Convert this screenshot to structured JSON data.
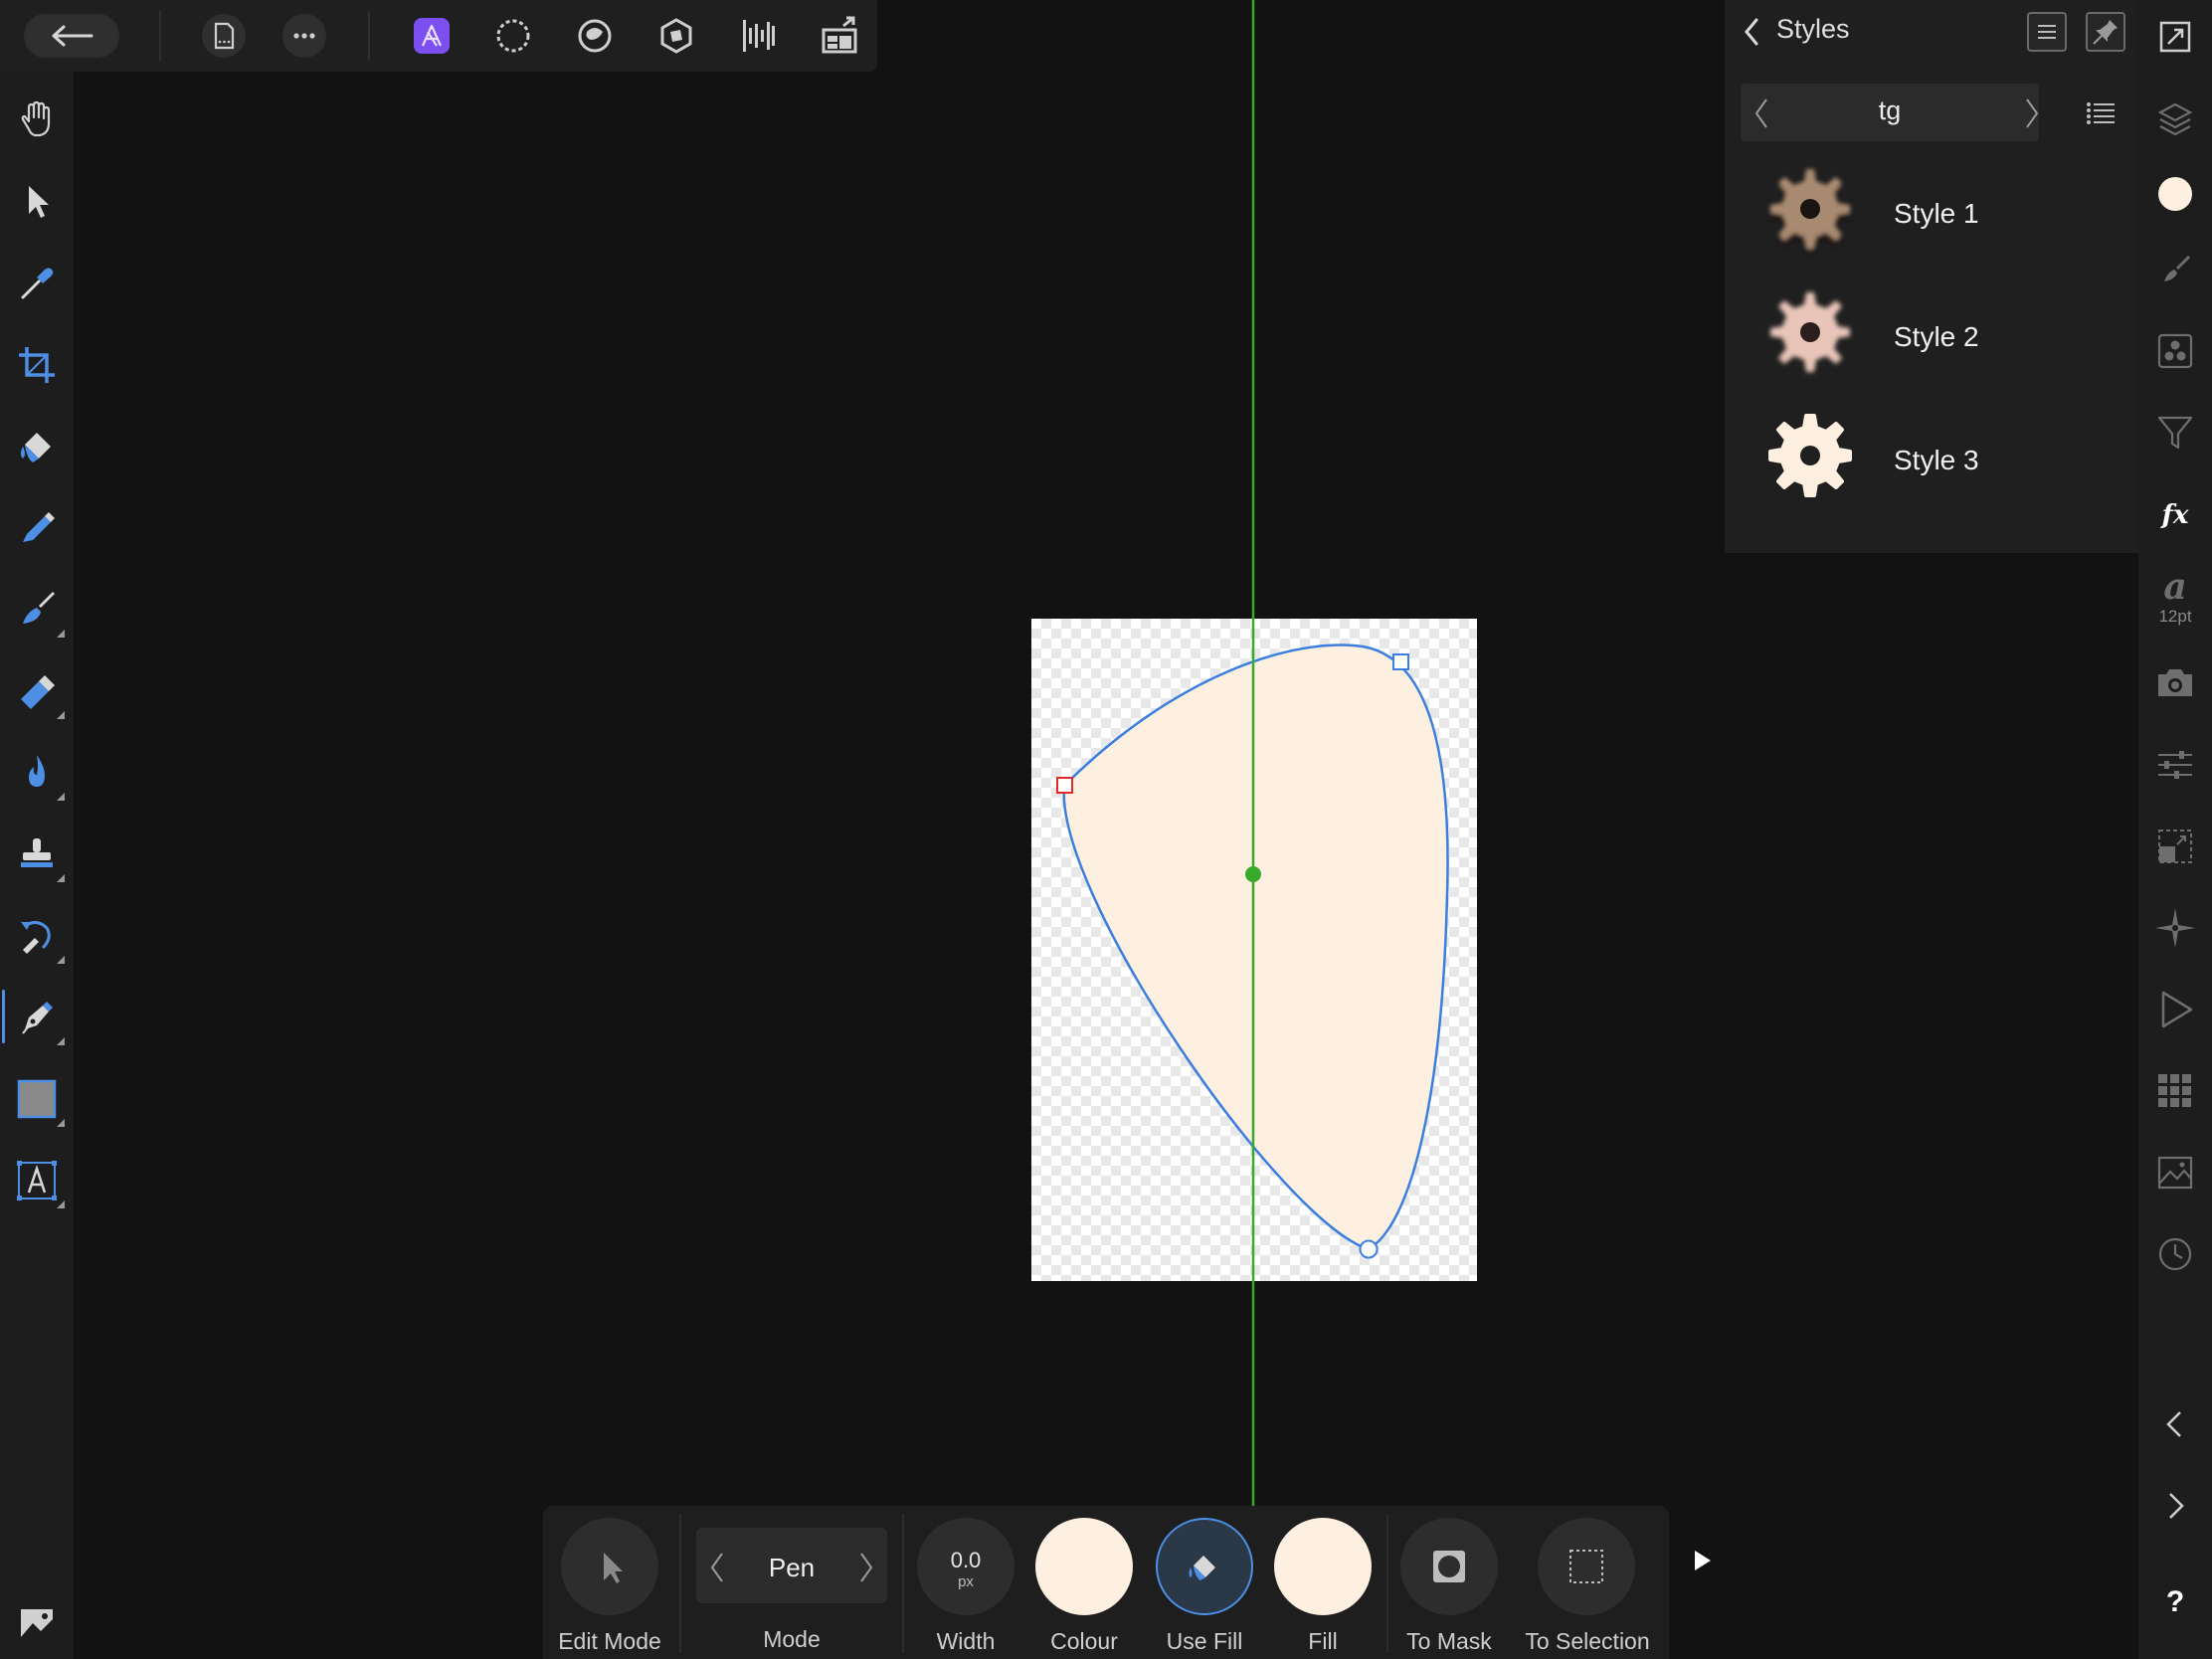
{
  "styles_panel": {
    "title": "Styles",
    "category": "tg",
    "items": [
      {
        "label": "Style 1",
        "swatch_color": "#a88a70"
      },
      {
        "label": "Style 2",
        "swatch_color": "#e8c5b8"
      },
      {
        "label": "Style 3",
        "swatch_color": "#fdf0e0"
      }
    ]
  },
  "right_rail": {
    "font_size_label": "12pt"
  },
  "context_toolbar": {
    "edit_mode_label": "Edit Mode",
    "mode_value": "Pen",
    "mode_label": "Mode",
    "width_value": "0.0",
    "width_unit": "px",
    "width_label": "Width",
    "colour_label": "Colour",
    "use_fill_label": "Use Fill",
    "fill_label": "Fill",
    "to_mask_label": "To Mask",
    "to_selection_label": "To Selection"
  },
  "colors": {
    "fill_color": "#fdf0e0",
    "guide_color": "#39a92a",
    "path_color": "#3a7ee0",
    "accent": "#4e8fe6",
    "persona_active": "#7b4ff0"
  },
  "help_label": "?"
}
